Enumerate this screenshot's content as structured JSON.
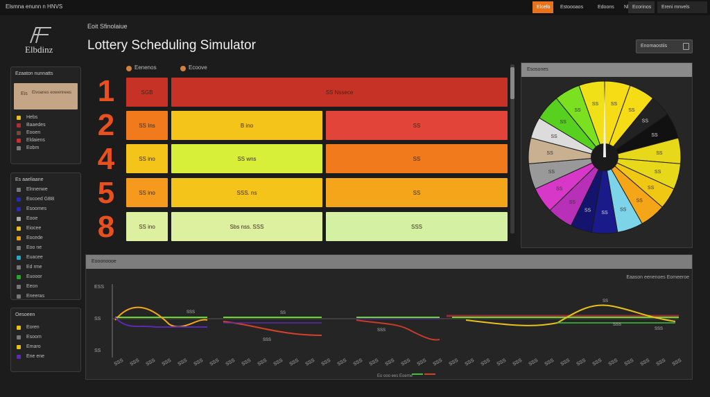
{
  "topbar": {
    "title": "Elsmna enunn n HNVS",
    "buttons": [
      "Elcefo",
      "Estoooaos",
      "Edoons",
      "Nl",
      "Ecorinos",
      "Ereni mnvels"
    ]
  },
  "logo": {
    "text": "Elbdinz"
  },
  "breadcrumb": "Eoit Sfinolaiue",
  "page_title": "Lottery Scheduling Simulator",
  "header_button": {
    "label": "Enomaostiis"
  },
  "panels": {
    "processes": {
      "heading": "Ezaaton nunnatts",
      "selected": {
        "code": "Eis",
        "text": "Elvoanes eowennees"
      },
      "items": [
        {
          "label": "Hebs",
          "color": "#e8c21a"
        },
        {
          "label": "Baaedes",
          "color": "#b03030"
        },
        {
          "label": "Eooen",
          "color": "#6a4a3a"
        },
        {
          "label": "Eldaiens",
          "color": "#c83030"
        },
        {
          "label": "Eobm",
          "color": "#7a7a7a"
        }
      ]
    },
    "threads": {
      "heading": "Es aaeliaane",
      "items": [
        {
          "label": "Elnnenwe",
          "color": "#777777"
        },
        {
          "label": "Eocoed GBB",
          "color": "#2a2ab8"
        },
        {
          "label": "Esoomes",
          "color": "#2a2ab8"
        },
        {
          "label": "Eooe",
          "color": "#aaaaaa"
        },
        {
          "label": "Eiocee",
          "color": "#e8c21a"
        },
        {
          "label": "Eocede",
          "color": "#e8a21a"
        },
        {
          "label": "Eoo ne",
          "color": "#777777"
        },
        {
          "label": "Euacee",
          "color": "#2aa8c8"
        },
        {
          "label": "Ed  rme",
          "color": "#777777"
        },
        {
          "label": "Euooor",
          "color": "#22aa22"
        },
        {
          "label": "Eeon",
          "color": "#777777"
        },
        {
          "label": "Eneeras",
          "color": "#777777"
        }
      ]
    },
    "options": {
      "heading": "Oesoeen",
      "items": [
        {
          "label": "Eoren",
          "color": "#e8c21a"
        },
        {
          "label": "Esoom",
          "color": "#777777"
        },
        {
          "label": "Emaro",
          "color": "#e8c21a"
        },
        {
          "label": "Ene ene",
          "color": "#5a2ab0"
        }
      ]
    }
  },
  "queue": {
    "legend": [
      "Eenenos",
      "Ecoove"
    ],
    "priorities": [
      "1",
      "2",
      "4",
      "5",
      "8"
    ],
    "rows": [
      {
        "tickets": "SGB",
        "cells": [
          {
            "text": "SS Nssece",
            "color": "#c63226"
          }
        ]
      },
      {
        "tickets": "SS Ins",
        "cells": [
          {
            "text": "B ino",
            "color": "#f5c41a"
          },
          {
            "text": "SS",
            "color": "#e2443a"
          }
        ]
      },
      {
        "tickets": "SS ino",
        "cells": [
          {
            "text": "SS wns",
            "color": "#d8ef3a"
          },
          {
            "text": "SS",
            "color": "#f07a1c"
          }
        ]
      },
      {
        "tickets": "SS ino",
        "cells": [
          {
            "text": "SSS. ns",
            "color": "#f5c41a"
          },
          {
            "text": "SS",
            "color": "#f5a51a"
          }
        ]
      },
      {
        "tickets": "SS ino",
        "cells": [
          {
            "text": "Sbs nss. SSS",
            "color": "#dcf0a0"
          },
          {
            "text": "SSS",
            "color": "#d4f0a2"
          }
        ]
      }
    ],
    "ticket_colors": [
      "#c63226",
      "#f07a1c",
      "#f5c41a",
      "#f59a1c",
      "#dcf0a0"
    ]
  },
  "wheel": {
    "heading": "Esosones",
    "segments": [
      {
        "value": 6,
        "color": "#f5dc14",
        "label": "SS"
      },
      {
        "value": 6,
        "color": "#f5dc14",
        "label": "SS"
      },
      {
        "value": 5,
        "color": "#222222",
        "label": "SS"
      },
      {
        "value": 6,
        "color": "#111111",
        "label": "SS"
      },
      {
        "value": 6,
        "color": "#e8d81a",
        "label": "SS"
      },
      {
        "value": 6,
        "color": "#e8d81a",
        "label": "SS"
      },
      {
        "value": 5,
        "color": "#f0c814",
        "label": "SS"
      },
      {
        "value": 6,
        "color": "#f5a518",
        "label": "SS"
      },
      {
        "value": 6,
        "color": "#7dd4e8",
        "label": "SS"
      },
      {
        "value": 6,
        "color": "#1a1a8a",
        "label": "SS"
      },
      {
        "value": 5,
        "color": "#14146e",
        "label": "SS"
      },
      {
        "value": 6,
        "color": "#b830b8",
        "label": "SS"
      },
      {
        "value": 6,
        "color": "#d838c8",
        "label": "SS"
      },
      {
        "value": 6,
        "color": "#999999",
        "label": "SS"
      },
      {
        "value": 6,
        "color": "#c8b090",
        "label": "SS"
      },
      {
        "value": 5,
        "color": "#dcdcdc",
        "label": "SS"
      },
      {
        "value": 6,
        "color": "#58d020",
        "label": "SS"
      },
      {
        "value": 6,
        "color": "#7ae020",
        "label": "SS"
      },
      {
        "value": 6,
        "color": "#f0e018",
        "label": "SS"
      }
    ]
  },
  "timeline": {
    "heading": "Eooonoooe",
    "title": "Eaason eenenoes Eomeeroe",
    "y_labels": [
      "ESS",
      "SS",
      "SS"
    ],
    "x_labels": [
      "SSS",
      "SSS",
      "SSS",
      "SSS",
      "SSS",
      "SSS",
      "SSS",
      "SSS",
      "SSS",
      "SSS",
      "SSS",
      "SSS",
      "SSS",
      "SSS",
      "SSS",
      "SSS",
      "SSS",
      "SSS",
      "SSS",
      "SSS",
      "SSS",
      "SSS",
      "SSS",
      "SSS",
      "SSS",
      "SSS",
      "SSS",
      "SSS",
      "SSS",
      "SSS",
      "SSS",
      "SSS",
      "SSS",
      "SSS",
      "SSS",
      "SSS"
    ],
    "annotations": [
      "SSS",
      "SS",
      "SSS",
      "SSS",
      "SS",
      "SSS",
      "SSS"
    ],
    "axis_caption": "Eo ooo ees Eoeme"
  }
}
